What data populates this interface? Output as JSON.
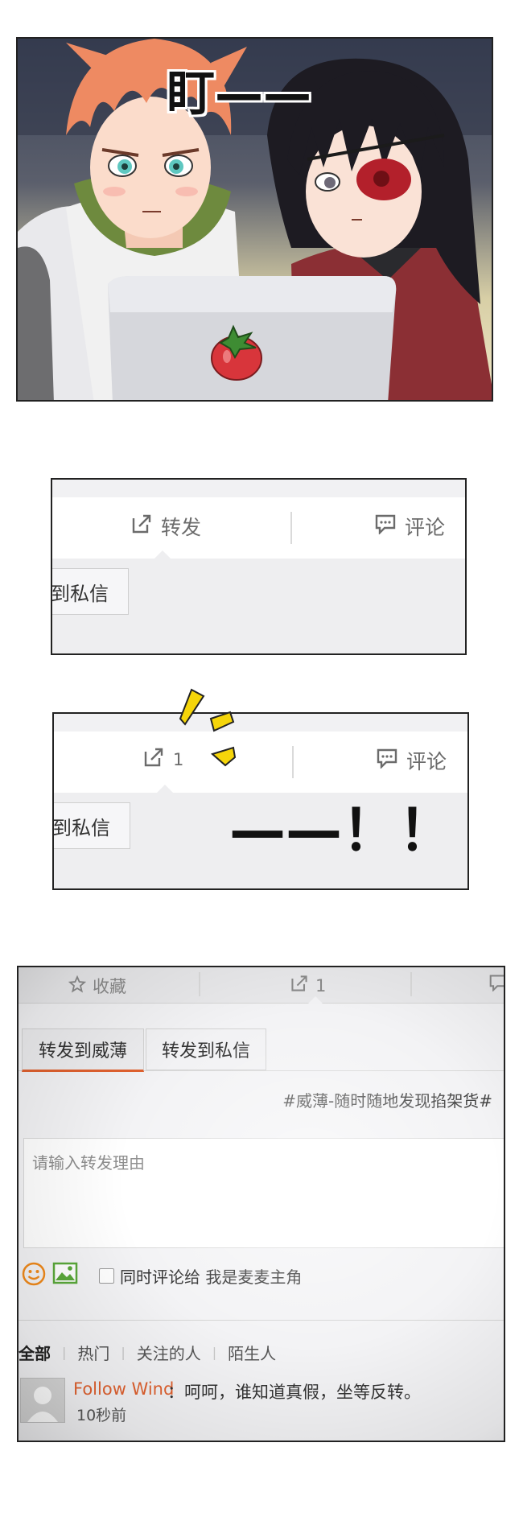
{
  "panel1": {
    "sfx": "盯——",
    "laptop_logo": "tomato-logo"
  },
  "panel2": {
    "repost_label": "转发",
    "comment_label": "评论",
    "private_msg_label": "到私信",
    "icons": {
      "repost": "share-arrow-icon",
      "comment": "speech-bubble-icon"
    }
  },
  "panel3": {
    "repost_count": "1",
    "comment_label": "评论",
    "private_msg_label": "到私信",
    "sfx": "——！！"
  },
  "panel4": {
    "top_bar": {
      "favorite_label": "收藏",
      "repost_count": "1"
    },
    "tabs": [
      {
        "label": "转发到威薄",
        "active": true
      },
      {
        "label": "转发到私信",
        "active": false
      }
    ],
    "hashtag": "#威薄-随时随地发现掐架货#",
    "reason_placeholder": "请输入转发理由",
    "also_comment_label": "同时评论给 我是麦麦主角",
    "filters": [
      "全部",
      "热门",
      "关注的人",
      "陌生人"
    ],
    "comment": {
      "user": "Follow Wind",
      "text": "：呵呵，谁知道真假，坐等反转。",
      "time": "10秒前"
    }
  },
  "colors": {
    "accent": "#e0612f",
    "text_gray": "#6b6b6b",
    "emoji_orange": "#f08a1c",
    "image_green": "#5aa83a",
    "sfx_yellow": "#f5d50a"
  }
}
